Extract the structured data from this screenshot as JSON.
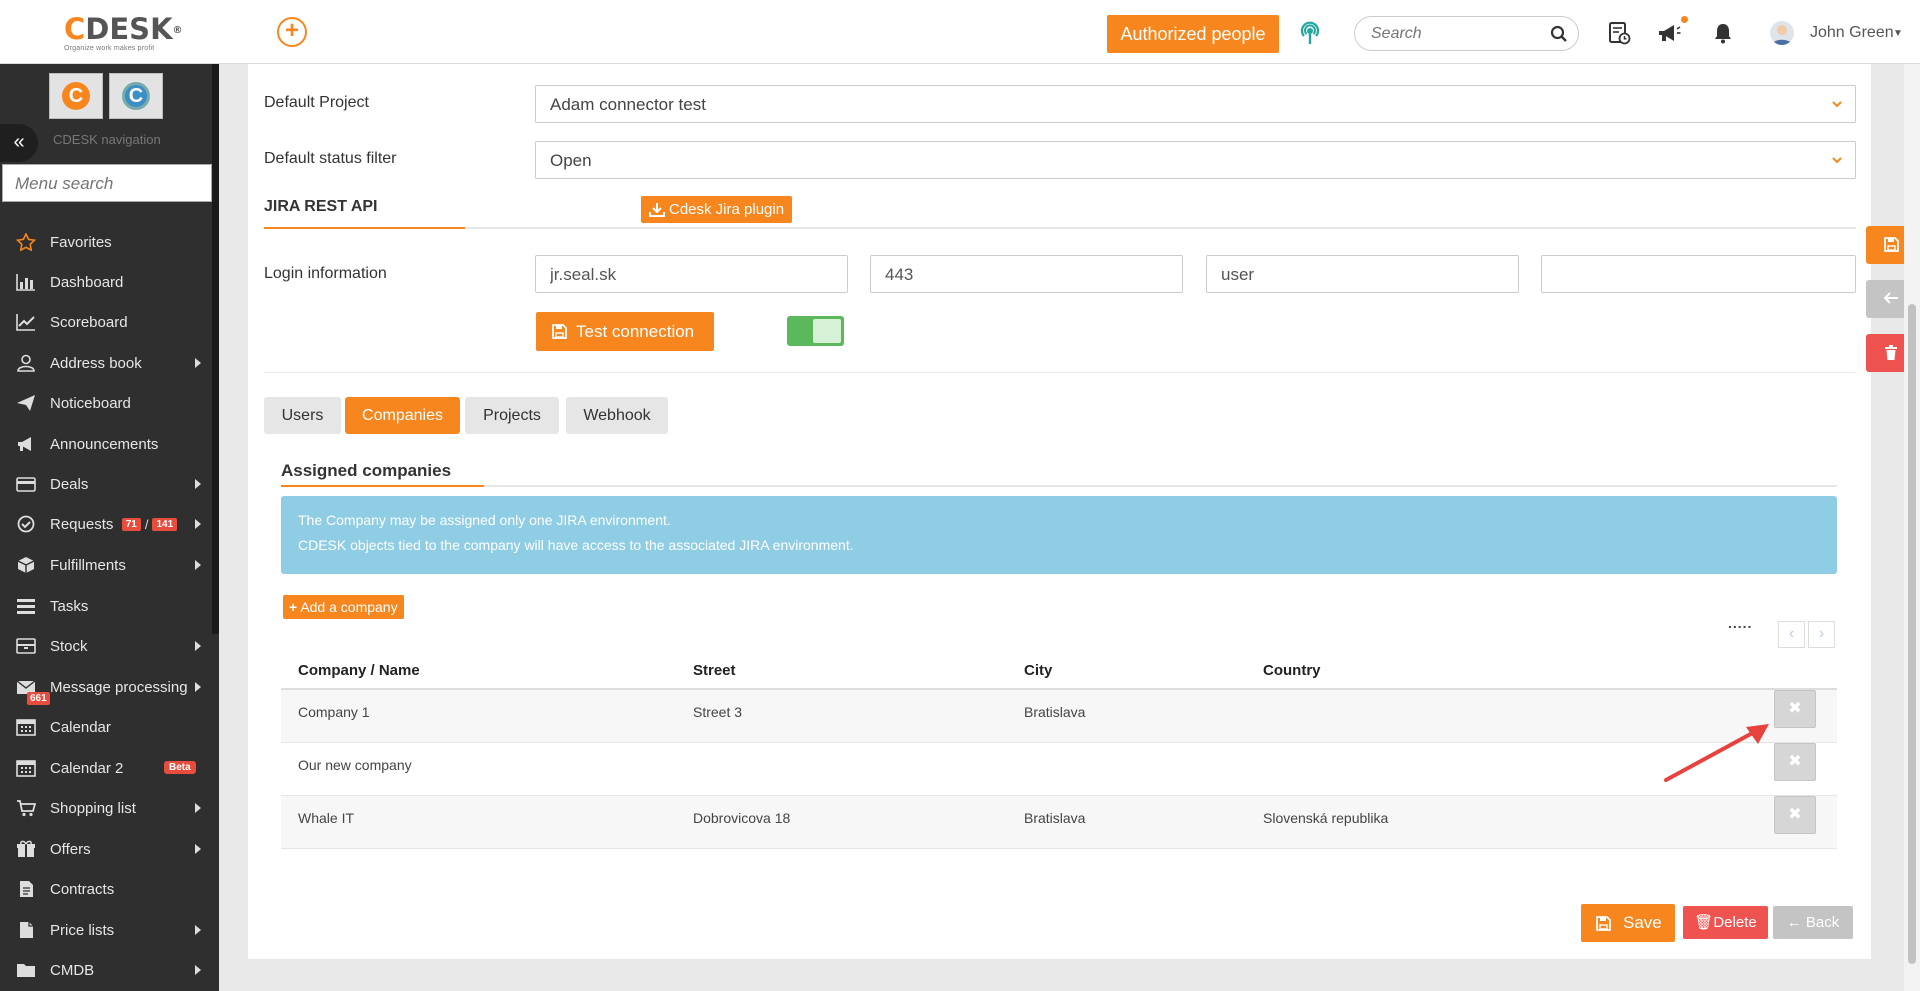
{
  "topbar": {
    "logo_text": "CDESK",
    "logo_tagline": "Organize work makes profit",
    "authorized_label": "Authorized people",
    "search_placeholder": "Search",
    "user_name": "John Green"
  },
  "sidebar": {
    "caption": "CDESK navigation",
    "search_placeholder": "Menu search",
    "app_tiles": [
      "C",
      "C"
    ],
    "items": [
      {
        "label": "Favorites",
        "icon": "star-icon"
      },
      {
        "label": "Dashboard",
        "icon": "bar-chart-icon"
      },
      {
        "label": "Scoreboard",
        "icon": "line-chart-icon"
      },
      {
        "label": "Address book",
        "icon": "user-icon",
        "submenu": true
      },
      {
        "label": "Noticeboard",
        "icon": "paper-plane-icon"
      },
      {
        "label": "Announcements",
        "icon": "megaphone-icon"
      },
      {
        "label": "Deals",
        "icon": "credit-card-icon",
        "submenu": true
      },
      {
        "label": "Requests",
        "icon": "check-circle-icon",
        "submenu": true,
        "badge_a": "71",
        "badge_b": "141",
        "badge_sep": "/"
      },
      {
        "label": "Fulfillments",
        "icon": "box-icon",
        "submenu": true
      },
      {
        "label": "Tasks",
        "icon": "list-icon"
      },
      {
        "label": "Stock",
        "icon": "stock-icon",
        "submenu": true
      },
      {
        "label": "Message processing",
        "icon": "envelope-icon",
        "submenu": true,
        "badge": "661"
      },
      {
        "label": "Calendar",
        "icon": "calendar-icon"
      },
      {
        "label": "Calendar 2",
        "icon": "calendar-icon",
        "beta": "Beta"
      },
      {
        "label": "Shopping list",
        "icon": "cart-icon",
        "submenu": true
      },
      {
        "label": "Offers",
        "icon": "gift-icon",
        "submenu": true
      },
      {
        "label": "Contracts",
        "icon": "document-icon"
      },
      {
        "label": "Price lists",
        "icon": "file-icon",
        "submenu": true
      },
      {
        "label": "CMDB",
        "icon": "folder-icon",
        "submenu": true
      }
    ]
  },
  "form": {
    "default_project_label": "Default Project",
    "default_project_value": "Adam connector test",
    "default_status_label": "Default status filter",
    "default_status_value": "Open",
    "jira_section_title": "JIRA REST API",
    "plugin_button": "Cdesk Jira plugin",
    "login_label": "Login information",
    "login_host": "jr.seal.sk",
    "login_port": "443",
    "login_user": "user",
    "login_password": "",
    "test_button": "Test connection",
    "toggle_on": true
  },
  "tabs": [
    {
      "label": "Users",
      "active": false
    },
    {
      "label": "Companies",
      "active": true
    },
    {
      "label": "Projects",
      "active": false
    },
    {
      "label": "Webhook",
      "active": false
    }
  ],
  "companies": {
    "title": "Assigned companies",
    "info_line1": "The Company may be assigned only one JIRA environment.",
    "info_line2": "CDESK objects tied to the company will have access to the associated JIRA environment.",
    "add_button": "Add a company",
    "pagination_dots": ".....",
    "columns": [
      "Company / Name",
      "Street",
      "City",
      "Country"
    ],
    "rows": [
      {
        "name": "Company 1",
        "street": "Street 3",
        "city": "Bratislava",
        "country": ""
      },
      {
        "name": "Our new company",
        "street": "",
        "city": "",
        "country": ""
      },
      {
        "name": "Whale IT",
        "street": "Dobrovicova 18",
        "city": "Bratislava",
        "country": "Slovenská republika"
      }
    ]
  },
  "actions": {
    "save": "Save",
    "delete": "Delete",
    "back": "Back"
  },
  "colors": {
    "accent": "#f7861e",
    "danger": "#ef5350",
    "sidebar_bg": "#2f2f2f",
    "info_bg": "#8fcde4",
    "toggle_on": "#5cb85c"
  }
}
